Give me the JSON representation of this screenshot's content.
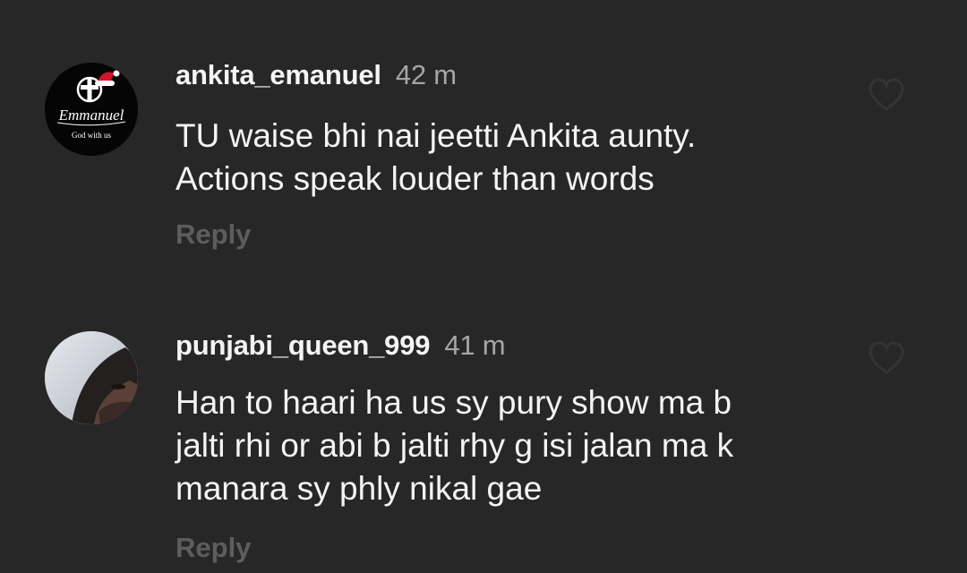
{
  "comments": [
    {
      "username": "ankita_emanuel",
      "time": "42 m",
      "lines": [
        "TU waise bhi nai jeetti Ankita aunty.",
        "Actions speak louder than words"
      ],
      "reply_label": "Reply",
      "avatar": {
        "logo_text": "Emmanuel",
        "logo_subtext": "God with us",
        "icon": "cross-with-santa-hat-icon"
      },
      "like_icon": "heart-outline-icon"
    },
    {
      "username": "punjabi_queen_999",
      "time": "41 m",
      "lines": [
        "Han to haari ha us sy pury show ma b",
        "jalti rhi or abi b jalti rhy g isi jalan ma k",
        "manara sy phly nikal gae"
      ],
      "reply_label": "Reply",
      "avatar": {
        "icon": "profile-photo"
      },
      "like_icon": "heart-outline-icon"
    }
  ],
  "colors": {
    "background": "#272727",
    "text": "#f4f4f4",
    "time": "#a6a6a6",
    "reply": "#5d5d5d"
  }
}
